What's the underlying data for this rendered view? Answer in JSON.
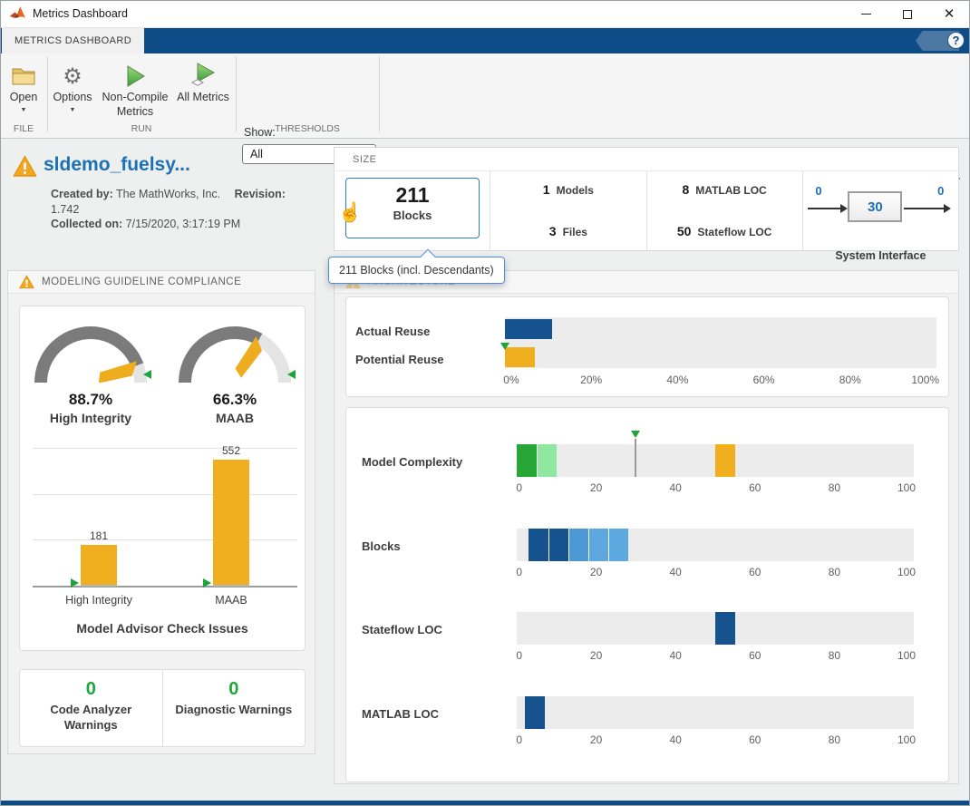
{
  "colors": {
    "navy": "#15528E",
    "amber": "#EFAF1F",
    "green": "#28A638",
    "light_green": "#90E8A0",
    "blue_med": "#4D99D6",
    "blue_light": "#5EA8E0",
    "marker_green": "#1CA53A",
    "ribbon_blue": "#0E4C87",
    "link_blue": "#1C70B5",
    "selected_border": "#2F7DC1",
    "warning_orange": "#F2A51E",
    "zero_green": "#1FA63B"
  },
  "icons": {
    "help_glyph": "?",
    "caret_down": "▼",
    "cursor_hand": "☝",
    "close_glyph": "✕"
  },
  "window": {
    "title": "Metrics Dashboard"
  },
  "ribbon": {
    "tab": "METRICS DASHBOARD"
  },
  "toolbar": {
    "open_label": "Open",
    "options_label": "Options",
    "non_compile_label": "Non-Compile Metrics",
    "all_metrics_label": "All Metrics",
    "show_label": "Show:",
    "show_value": "All",
    "file_section": "FILE",
    "run_section": "RUN",
    "thresholds_section": "THRESHOLDS"
  },
  "model": {
    "name": "sldemo_fuelsy...",
    "created_by_label": "Created by:",
    "created_by": "The MathWorks, Inc.",
    "revision_label": "Revision:",
    "revision": "1.742",
    "collected_label": "Collected on:",
    "collected": "7/15/2020, 3:17:19 PM"
  },
  "size_panel": {
    "header": "SIZE",
    "blocks_value": "211",
    "blocks_label": "Blocks",
    "models_value": "1",
    "models_label": "Models",
    "files_value": "3",
    "files_label": "Files",
    "matlab_value": "8",
    "matlab_label": "MATLAB LOC",
    "stateflow_value": "50",
    "stateflow_label": "Stateflow LOC",
    "iface_in": "0",
    "iface_center": "30",
    "iface_out": "0",
    "iface_label": "System Interface"
  },
  "tooltip_text": "211 Blocks (incl. Descendants)",
  "compliance_panel": {
    "header": "MODELING GUIDELINE COMPLIANCE",
    "warnings": [
      {
        "value": "0",
        "label": "Code Analyzer Warnings"
      },
      {
        "value": "0",
        "label": "Diagnostic Warnings"
      }
    ]
  },
  "architecture_panel": {
    "header": "ARCHITECTURE"
  },
  "chart_data": [
    {
      "id": "compliance_gauges",
      "type": "gauge",
      "series": [
        {
          "label": "High Integrity",
          "value": 88.7,
          "display": "88.7%"
        },
        {
          "label": "MAAB",
          "value": 66.3,
          "display": "66.3%"
        }
      ],
      "range": [
        0,
        100
      ]
    },
    {
      "id": "model_advisor_issues",
      "type": "bar",
      "title": "Model Advisor Check Issues",
      "categories": [
        "High Integrity",
        "MAAB"
      ],
      "values": [
        181,
        552
      ],
      "ylim": [
        0,
        600
      ],
      "gridlines": [
        200,
        400,
        600
      ],
      "bar_color": "amber",
      "baseline_markers": true
    },
    {
      "id": "reuse",
      "type": "bar-horizontal",
      "categories": [
        "Actual Reuse",
        "Potential Reuse"
      ],
      "values_pct": [
        11,
        7
      ],
      "bar_colors": [
        "navy",
        "amber"
      ],
      "threshold_marker_pct": 0,
      "xticks": [
        "0%",
        "20%",
        "40%",
        "60%",
        "80%",
        "100%"
      ],
      "xlim": [
        0,
        100
      ]
    },
    {
      "id": "distributions",
      "type": "segmented-strip",
      "xticks": [
        "0",
        "20",
        "40",
        "60",
        "80",
        "100"
      ],
      "xlim": [
        0,
        100
      ],
      "rows": [
        {
          "label": "Model Complexity",
          "marker": 30,
          "segments": [
            {
              "from": 0,
              "to": 5,
              "color": "green"
            },
            {
              "from": 5,
              "to": 10,
              "color": "light_green"
            },
            {
              "from": 50,
              "to": 55,
              "color": "amber"
            }
          ]
        },
        {
          "label": "Blocks",
          "segments": [
            {
              "from": 3,
              "to": 8,
              "color": "navy"
            },
            {
              "from": 8,
              "to": 13,
              "color": "navy"
            },
            {
              "from": 13,
              "to": 18,
              "color": "blue_med"
            },
            {
              "from": 18,
              "to": 23,
              "color": "blue_light"
            },
            {
              "from": 23,
              "to": 28,
              "color": "blue_light"
            }
          ]
        },
        {
          "label": "Stateflow LOC",
          "segments": [
            {
              "from": 50,
              "to": 55,
              "color": "navy"
            }
          ]
        },
        {
          "label": "MATLAB LOC",
          "segments": [
            {
              "from": 2,
              "to": 7,
              "color": "navy"
            }
          ]
        }
      ]
    }
  ]
}
